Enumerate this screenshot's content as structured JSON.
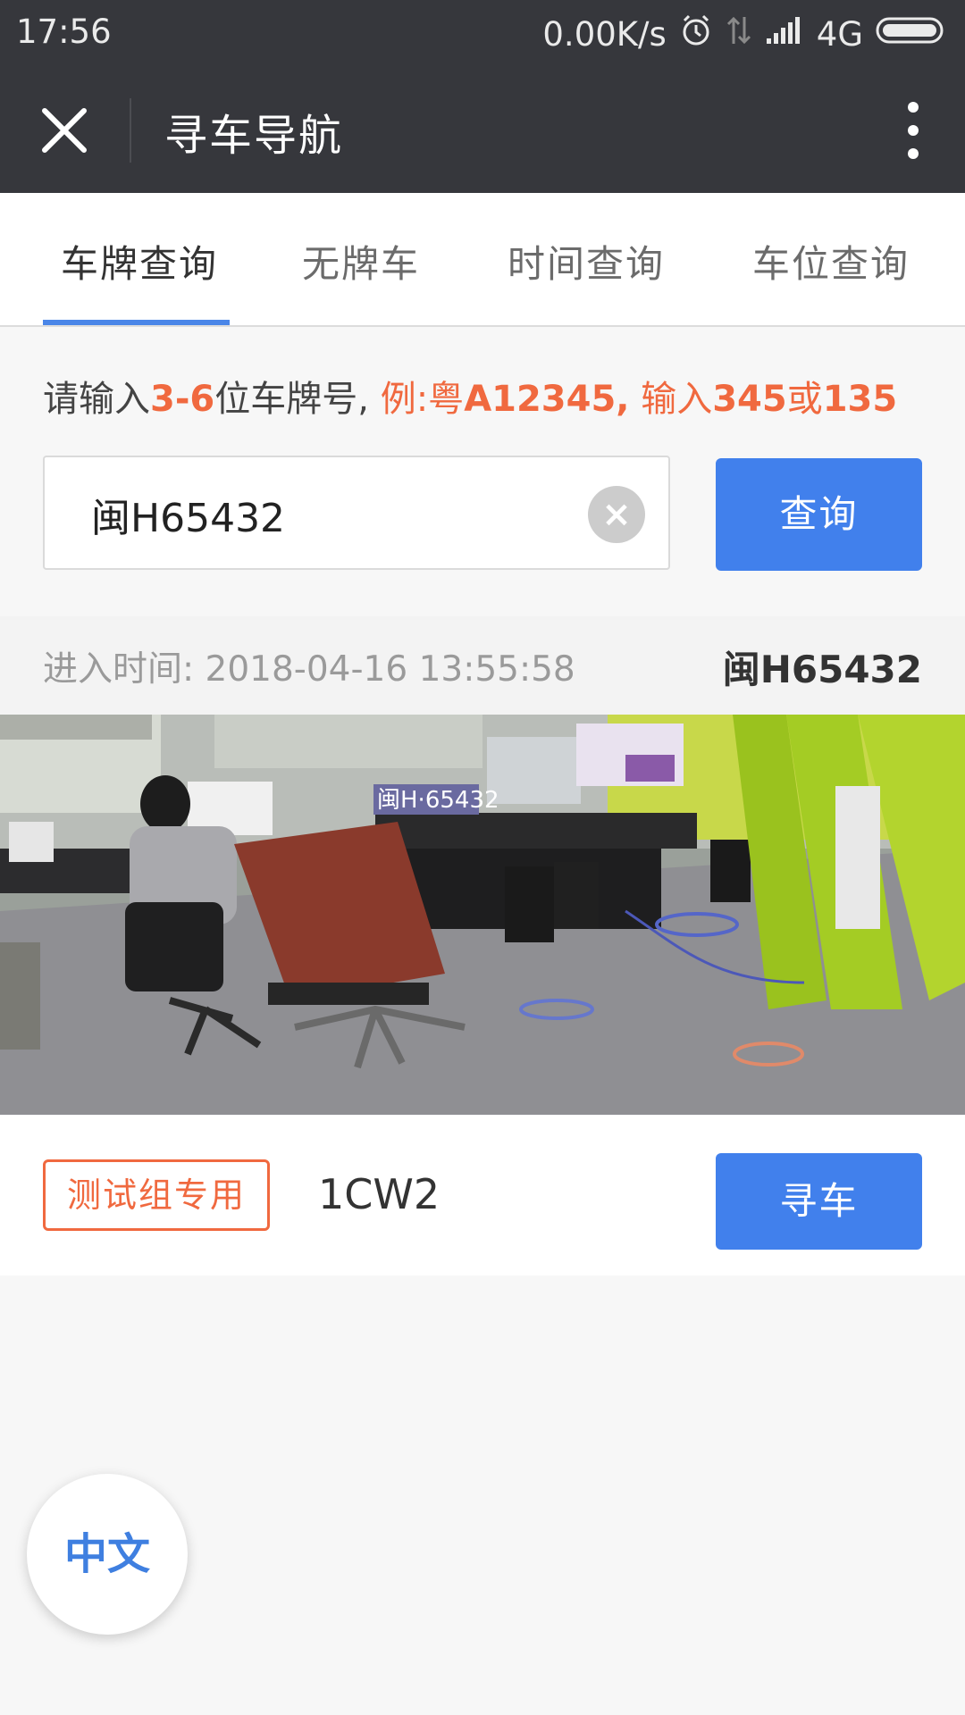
{
  "status_bar": {
    "time": "17:56",
    "net_speed": "0.00K/s",
    "network": "4G",
    "icons": [
      "alarm-icon",
      "data-arrows-icon",
      "signal-icon",
      "battery-icon"
    ]
  },
  "title_bar": {
    "title": "寻车导航",
    "icons": [
      "close-icon",
      "more-vert-icon"
    ]
  },
  "tabs": [
    {
      "label": "车牌查询",
      "active": true
    },
    {
      "label": "无牌车",
      "active": false
    },
    {
      "label": "时间查询",
      "active": false
    },
    {
      "label": "车位查询",
      "active": false
    }
  ],
  "hint": {
    "p1": "请输入",
    "p2": "3-6",
    "p3": "位车牌号, ",
    "p4": "例:粤",
    "p5": "A12345,",
    "p6": " 输入",
    "p7": "345",
    "p8": "或",
    "p9": "135"
  },
  "search": {
    "value": "闽H65432",
    "clear_icon": "close-circle-icon",
    "button_label": "查询"
  },
  "result": {
    "entry_label": "进入时间: 2018-04-16 13:55:58",
    "plate": "闽H65432",
    "snapshot_plate_text": "闽H·65432",
    "zone_tag": "测试组专用",
    "space_code": "1CW2",
    "find_button_label": "寻车"
  },
  "language_button": "中文",
  "colors": {
    "header_bg": "#36373c",
    "accent_blue": "#4180ec",
    "highlight_orange": "#f0693f",
    "page_bg": "#f7f7f7"
  }
}
